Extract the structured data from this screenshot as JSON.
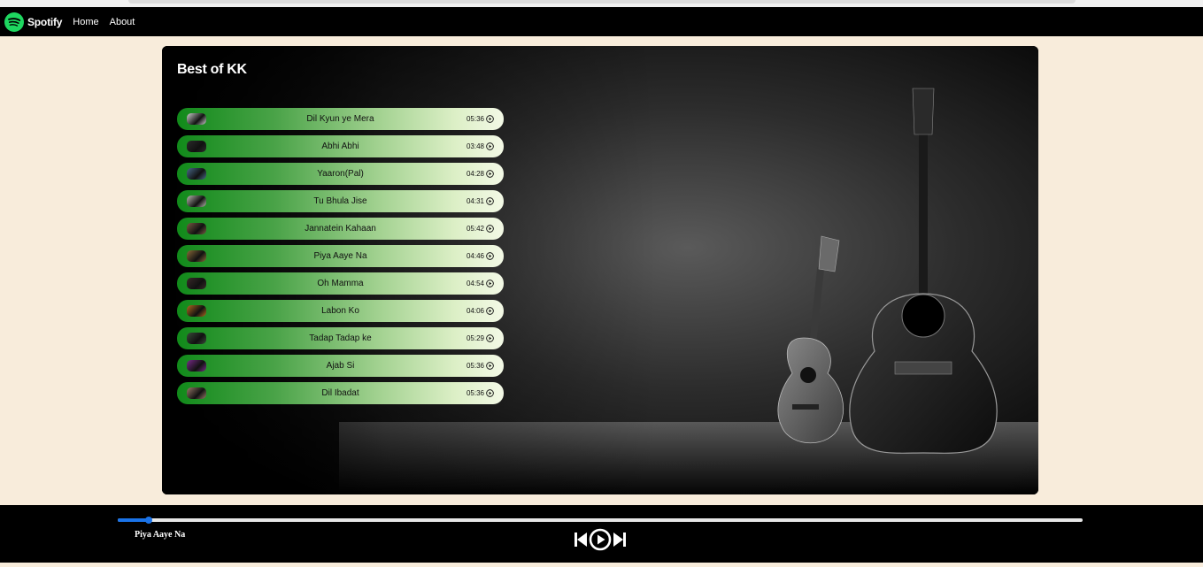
{
  "nav": {
    "brand": "Spotify",
    "links": [
      "Home",
      "About"
    ]
  },
  "playlist": {
    "title": "Best of KK",
    "songs": [
      {
        "name": "Dil Kyun ye Mera",
        "duration": "05:36",
        "thumb_color": "#cfcfcf"
      },
      {
        "name": "Abhi Abhi",
        "duration": "03:48",
        "thumb_color": "#2b2b2b"
      },
      {
        "name": "Yaaron(Pal)",
        "duration": "04:28",
        "thumb_color": "#4a6a8a"
      },
      {
        "name": "Tu Bhula Jise",
        "duration": "04:31",
        "thumb_color": "#b9b9b0"
      },
      {
        "name": "Jannatein Kahaan",
        "duration": "05:42",
        "thumb_color": "#7a5a44"
      },
      {
        "name": "Piya Aaye Na",
        "duration": "04:46",
        "thumb_color": "#8a6a3a"
      },
      {
        "name": "Oh Mamma",
        "duration": "04:54",
        "thumb_color": "#3a2a2a"
      },
      {
        "name": "Labon Ko",
        "duration": "04:06",
        "thumb_color": "#b06a20"
      },
      {
        "name": "Tadap Tadap ke",
        "duration": "05:29",
        "thumb_color": "#3a4a3a"
      },
      {
        "name": "Ajab Si",
        "duration": "05:36",
        "thumb_color": "#7a2a8a"
      },
      {
        "name": "Dil Ibadat",
        "duration": "05:36",
        "thumb_color": "#9a7a6a"
      }
    ]
  },
  "player": {
    "now_playing": "Piya Aaye Na",
    "progress": 0.032,
    "accent": "#1a73e8",
    "controls": [
      "previous-icon",
      "play-icon",
      "next-icon"
    ]
  },
  "colors": {
    "page_bg": "#f8ecdb",
    "bar_bg": "#000000",
    "brand_green": "#1ed760",
    "row_gradient_start": "#118a1a",
    "row_gradient_end": "#f3f9e6"
  }
}
